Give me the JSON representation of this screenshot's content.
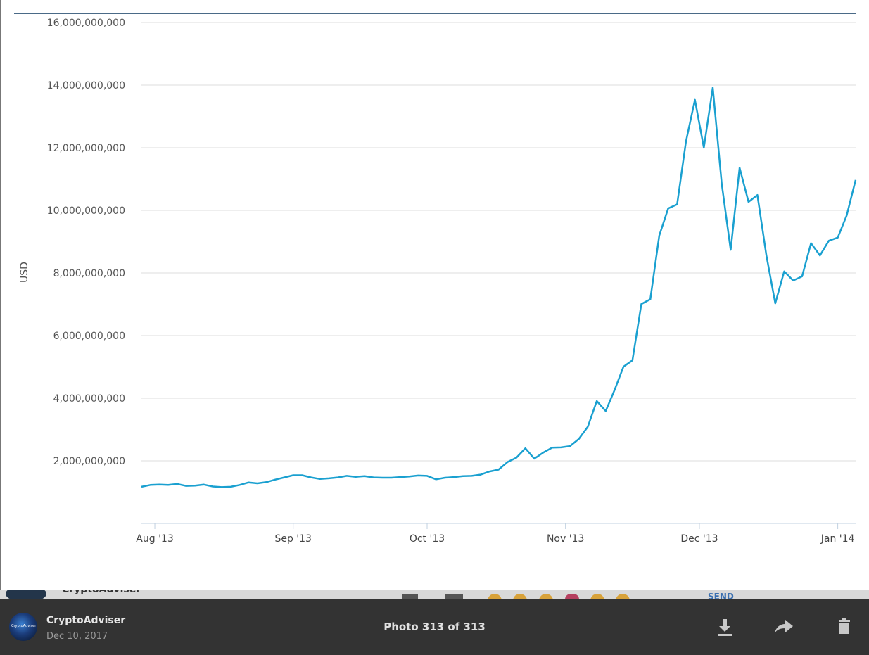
{
  "chart_data": {
    "type": "line",
    "title": "",
    "xlabel": "",
    "ylabel": "USD",
    "ylim": [
      0,
      16000000000
    ],
    "y_ticks": [
      "2,000,000,000",
      "4,000,000,000",
      "6,000,000,000",
      "8,000,000,000",
      "10,000,000,000",
      "12,000,000,000",
      "14,000,000,000",
      "16,000,000,000"
    ],
    "x_ticks": [
      "Aug '13",
      "Sep '13",
      "Oct '13",
      "Nov '13",
      "Dec '13",
      "Jan '14"
    ],
    "x_range": [
      "2013-07-29",
      "2014-01-05"
    ],
    "grid": true,
    "line_color": "#1aa0d0",
    "series": [
      {
        "x": [
          "2013-07-29",
          "2013-07-31",
          "2013-08-02",
          "2013-08-04",
          "2013-08-06",
          "2013-08-08",
          "2013-08-10",
          "2013-08-12",
          "2013-08-14",
          "2013-08-16",
          "2013-08-18",
          "2013-08-20",
          "2013-08-22",
          "2013-08-24",
          "2013-08-26",
          "2013-08-28",
          "2013-08-30",
          "2013-09-01",
          "2013-09-03",
          "2013-09-05",
          "2013-09-07",
          "2013-09-09",
          "2013-09-11",
          "2013-09-13",
          "2013-09-15",
          "2013-09-17",
          "2013-09-19",
          "2013-09-21",
          "2013-09-23",
          "2013-09-25",
          "2013-09-27",
          "2013-09-29",
          "2013-10-01",
          "2013-10-03",
          "2013-10-05",
          "2013-10-07",
          "2013-10-09",
          "2013-10-11",
          "2013-10-13",
          "2013-10-15",
          "2013-10-17",
          "2013-10-19",
          "2013-10-21",
          "2013-10-23",
          "2013-10-25",
          "2013-10-27",
          "2013-10-29",
          "2013-10-31",
          "2013-11-02",
          "2013-11-04",
          "2013-11-06",
          "2013-11-08",
          "2013-11-10",
          "2013-11-12",
          "2013-11-14",
          "2013-11-16",
          "2013-11-18",
          "2013-11-20",
          "2013-11-22",
          "2013-11-24",
          "2013-11-26",
          "2013-11-28",
          "2013-11-30",
          "2013-12-02",
          "2013-12-04",
          "2013-12-06",
          "2013-12-08",
          "2013-12-10",
          "2013-12-12",
          "2013-12-14",
          "2013-12-16",
          "2013-12-18",
          "2013-12-20",
          "2013-12-22",
          "2013-12-24",
          "2013-12-26",
          "2013-12-28",
          "2013-12-30",
          "2014-01-01",
          "2014-01-03",
          "2014-01-05"
        ],
        "values": [
          1170000000,
          1230000000,
          1240000000,
          1230000000,
          1260000000,
          1200000000,
          1210000000,
          1240000000,
          1180000000,
          1160000000,
          1170000000,
          1230000000,
          1310000000,
          1280000000,
          1320000000,
          1400000000,
          1470000000,
          1540000000,
          1540000000,
          1470000000,
          1420000000,
          1440000000,
          1470000000,
          1520000000,
          1490000000,
          1510000000,
          1470000000,
          1460000000,
          1460000000,
          1480000000,
          1500000000,
          1530000000,
          1520000000,
          1410000000,
          1460000000,
          1480000000,
          1510000000,
          1520000000,
          1560000000,
          1660000000,
          1720000000,
          1960000000,
          2100000000,
          2400000000,
          2070000000,
          2260000000,
          2420000000,
          2430000000,
          2470000000,
          2700000000,
          3090000000,
          3910000000,
          3590000000,
          4260000000,
          5010000000,
          5210000000,
          7010000000,
          7160000000,
          9190000000,
          10060000000,
          10190000000,
          12200000000,
          13530000000,
          12000000000,
          13920000000,
          10850000000,
          8740000000,
          11360000000,
          10270000000,
          10490000000,
          8570000000,
          7030000000,
          8050000000,
          7760000000,
          7890000000,
          8950000000,
          8560000000,
          9030000000,
          9130000000,
          9840000000,
          10970000000
        ]
      }
    ]
  },
  "behind": {
    "name": "CryptoAdviser",
    "link": "SEND"
  },
  "viewer": {
    "author_name": "CryptoAdviser",
    "author_date": "Dec 10, 2017",
    "avatar_text": "CryptoAdviser",
    "counter": "Photo 313 of 313",
    "icons": [
      "download-icon",
      "share-icon",
      "trash-icon"
    ]
  }
}
